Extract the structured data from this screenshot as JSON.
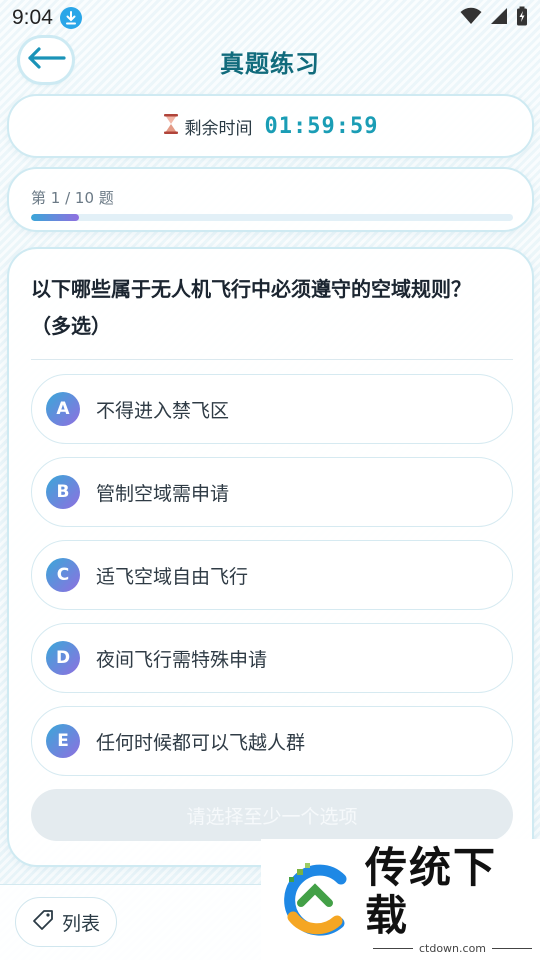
{
  "status_bar": {
    "time": "9:04"
  },
  "header": {
    "title": "真题练习"
  },
  "timer": {
    "label": "剩余时间",
    "value": "01:59:59"
  },
  "progress": {
    "text": "第 1 / 10 题",
    "fraction": 0.1
  },
  "question": {
    "text": "以下哪些属于无人机飞行中必须遵守的空域规则？（多选）",
    "options": [
      {
        "letter": "A",
        "text": "不得进入禁飞区"
      },
      {
        "letter": "B",
        "text": "管制空域需申请"
      },
      {
        "letter": "C",
        "text": "适飞空域自由飞行"
      },
      {
        "letter": "D",
        "text": "夜间飞行需特殊申请"
      },
      {
        "letter": "E",
        "text": "任何时候都可以飞越人群"
      }
    ],
    "submit_label": "请选择至少一个选项"
  },
  "bottom_bar": {
    "list_label": "列表"
  },
  "watermark": {
    "name": "传统下载",
    "url": "ctdown.com"
  },
  "colors": {
    "accent": "#1a9db5",
    "title": "#116b7c",
    "badge_start": "#3aa8d8",
    "badge_end": "#8f6fe0"
  },
  "icons": [
    "download-icon",
    "wifi-icon",
    "signal-icon",
    "battery-icon",
    "back-arrow-icon",
    "hourglass-icon",
    "tag-icon"
  ]
}
